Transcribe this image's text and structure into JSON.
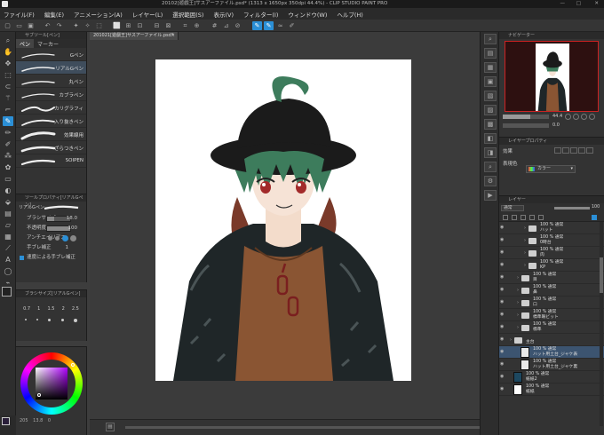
{
  "window": {
    "title": "20102[遊戯王]サスアーファイル.psd* (1313 x 1650px 350dpi 44.4%) - CLIP STUDIO PAINT PRO"
  },
  "menu": [
    "ファイル(F)",
    "編集(E)",
    "アニメーション(A)",
    "レイヤー(L)",
    "選択範囲(S)",
    "表示(V)",
    "フィルター(I)",
    "ウィンドウ(W)",
    "ヘルプ(H)"
  ],
  "canvas": {
    "tab": "201021[遊戯王]サスアーファイル.psd*",
    "tab_close": "×"
  },
  "subtool": {
    "title": "サブツール[ペン]",
    "tabs": [
      "ペン",
      "マーカー"
    ],
    "brushes": [
      "Gペン",
      "リアルGペン",
      "丸ペン",
      "カブラペン",
      "カリグラフィ",
      "入り抜きペン",
      "効果線用",
      "ざらつきペン",
      "SOIPEN"
    ],
    "selected": 1
  },
  "toolprop": {
    "title": "ツールプロパティ[リアルGペン]",
    "preset": "リアルGペン",
    "rows": [
      {
        "label": "ブラシサイズ",
        "value": "18.0"
      },
      {
        "label": "不透明度",
        "value": "100"
      },
      {
        "label": "アンチエイリアス",
        "value": ""
      },
      {
        "label": "手ブレ補正",
        "value": "1"
      },
      {
        "label": "速度による手ブレ補正",
        "value": ""
      }
    ],
    "size_fill": 0.3,
    "opacity_fill": 1.0
  },
  "brushsize": {
    "title": "ブラシサイズ[リアルGペン]",
    "sizes": [
      "0.7",
      "1",
      "1.5",
      "2",
      "2.5"
    ]
  },
  "status": {
    "zoom": "205",
    "pos": "13.8",
    "angle": "0"
  },
  "navigator": {
    "title": "ナビゲーター",
    "zoom": "44.4",
    "angle": "0.0"
  },
  "layerprop": {
    "title": "レイヤープロパティ",
    "effect_label": "効果",
    "color_label": "表現色",
    "color_value": "カラー"
  },
  "layers": {
    "title": "レイヤー",
    "blend": "通常",
    "opacity": "100",
    "items": [
      {
        "indent": 2,
        "type": "folder",
        "mode": "100 % 通常",
        "name": "ハット"
      },
      {
        "indent": 2,
        "type": "folder",
        "mode": "100 % 通常",
        "name": "0時台"
      },
      {
        "indent": 2,
        "type": "folder",
        "mode": "100 % 通常",
        "name": "肉"
      },
      {
        "indent": 2,
        "type": "folder",
        "mode": "100 % 通常",
        "name": "KP"
      },
      {
        "indent": 1,
        "type": "folder",
        "mode": "100 % 通常",
        "name": "目"
      },
      {
        "indent": 1,
        "type": "folder",
        "mode": "100 % 通常",
        "name": "鼻"
      },
      {
        "indent": 1,
        "type": "folder",
        "mode": "100 % 通常",
        "name": "口"
      },
      {
        "indent": 1,
        "type": "folder",
        "mode": "100 % 通常",
        "name": "標準眼ビット"
      },
      {
        "indent": 1,
        "type": "folder",
        "mode": "100 % 通常",
        "name": "標準"
      },
      {
        "indent": 0,
        "type": "folder",
        "mode": "",
        "name": "主台"
      },
      {
        "indent": 1,
        "type": "image",
        "mode": "100 % 通常",
        "name": "ハット用土台_ジャケ表",
        "sel": true
      },
      {
        "indent": 1,
        "type": "image",
        "mode": "100 % 通常",
        "name": "ハット用土台_ジャケ裏"
      },
      {
        "indent": 0,
        "type": "dark",
        "mode": "100 % 通常",
        "name": "紙紙2"
      },
      {
        "indent": 0,
        "type": "white",
        "mode": "100 % 通常",
        "name": "紙紙"
      }
    ]
  },
  "colors": {
    "accent": "#2b8fd6",
    "hair": "#3d7c5c",
    "hat": "#1b1b1b",
    "shirt": "#8a5533",
    "jacket": "#222a2b"
  }
}
